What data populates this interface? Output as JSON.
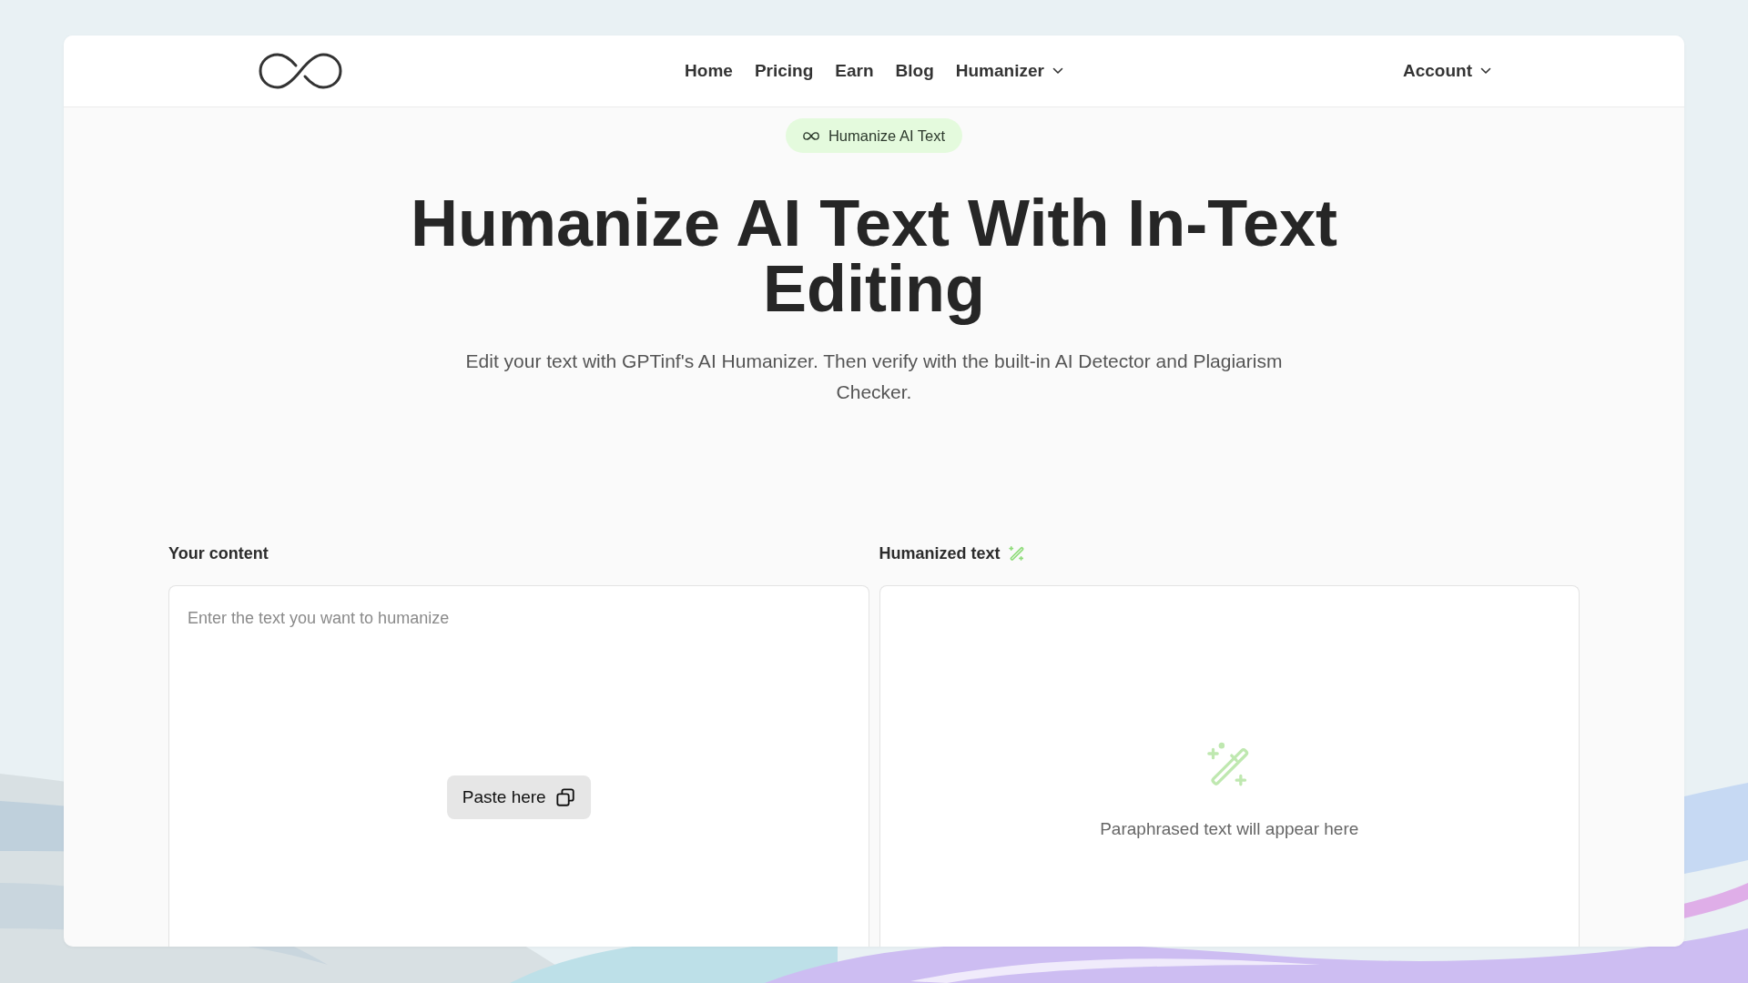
{
  "nav": {
    "links": [
      {
        "label": "Home",
        "kind": "link"
      },
      {
        "label": "Pricing",
        "kind": "link"
      },
      {
        "label": "Earn",
        "kind": "link"
      },
      {
        "label": "Blog",
        "kind": "link"
      },
      {
        "label": "Humanizer",
        "kind": "dropdown"
      }
    ],
    "account": "Account"
  },
  "hero": {
    "tag": "Humanize AI Text",
    "title": "Humanize AI Text With In-Text Editing",
    "subtitle": "Edit your text with GPTinf's AI Humanizer. Then verify with the built-in AI Detector and Plagiarism Checker."
  },
  "editor": {
    "input": {
      "label": "Your content",
      "placeholder": "Enter the text you want to humanize",
      "paste_button": "Paste here"
    },
    "output": {
      "label": "Humanized text",
      "empty_message": "Paraphrased text will appear here"
    }
  }
}
